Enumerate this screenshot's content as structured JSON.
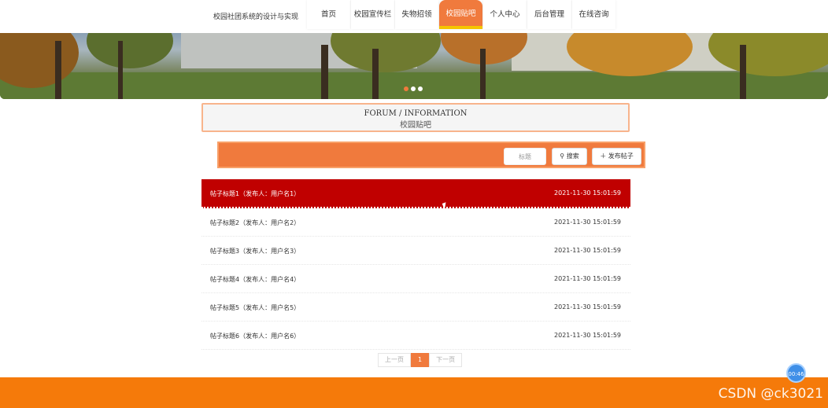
{
  "header": {
    "site_title": "校园社团系统的设计与实现",
    "nav": [
      {
        "label": "首页",
        "width": 55
      },
      {
        "label": "校园宣传栏",
        "width": 55
      },
      {
        "label": "失物招领",
        "width": 55
      },
      {
        "label": "校园贴吧",
        "width": 55,
        "active": true
      },
      {
        "label": "个人中心",
        "width": 55
      },
      {
        "label": "后台管理",
        "width": 56
      },
      {
        "label": "在线咨询",
        "width": 55
      }
    ]
  },
  "banner": {
    "slide_count": 3,
    "active_index": 0
  },
  "section": {
    "title_en": "FORUM / INFORMATION",
    "title_cn": "校园贴吧"
  },
  "search": {
    "placeholder": "标题",
    "search_label": "搜索",
    "post_label": "发布帖子"
  },
  "posts": [
    {
      "title": "帖子标题1（发布人：用户名1）",
      "date": "2021-11-30 15:01:59"
    },
    {
      "title": "帖子标题2（发布人：用户名2）",
      "date": "2021-11-30 15:01:59"
    },
    {
      "title": "帖子标题3（发布人：用户名3）",
      "date": "2021-11-30 15:01:59"
    },
    {
      "title": "帖子标题4（发布人：用户名4）",
      "date": "2021-11-30 15:01:59"
    },
    {
      "title": "帖子标题5（发布人：用户名5）",
      "date": "2021-11-30 15:01:59"
    },
    {
      "title": "帖子标题6（发布人：用户名6）",
      "date": "2021-11-30 15:01:59"
    }
  ],
  "pagination": {
    "prev": "上一页",
    "current": "1",
    "next": "下一页"
  },
  "overlay": {
    "timer": "00:46",
    "watermark": "CSDN @ck3021"
  },
  "colors": {
    "accent": "#f07a3d",
    "highlight_row": "#c00000",
    "footer": "#f57a0a",
    "nav_underline": "#f5c400"
  }
}
